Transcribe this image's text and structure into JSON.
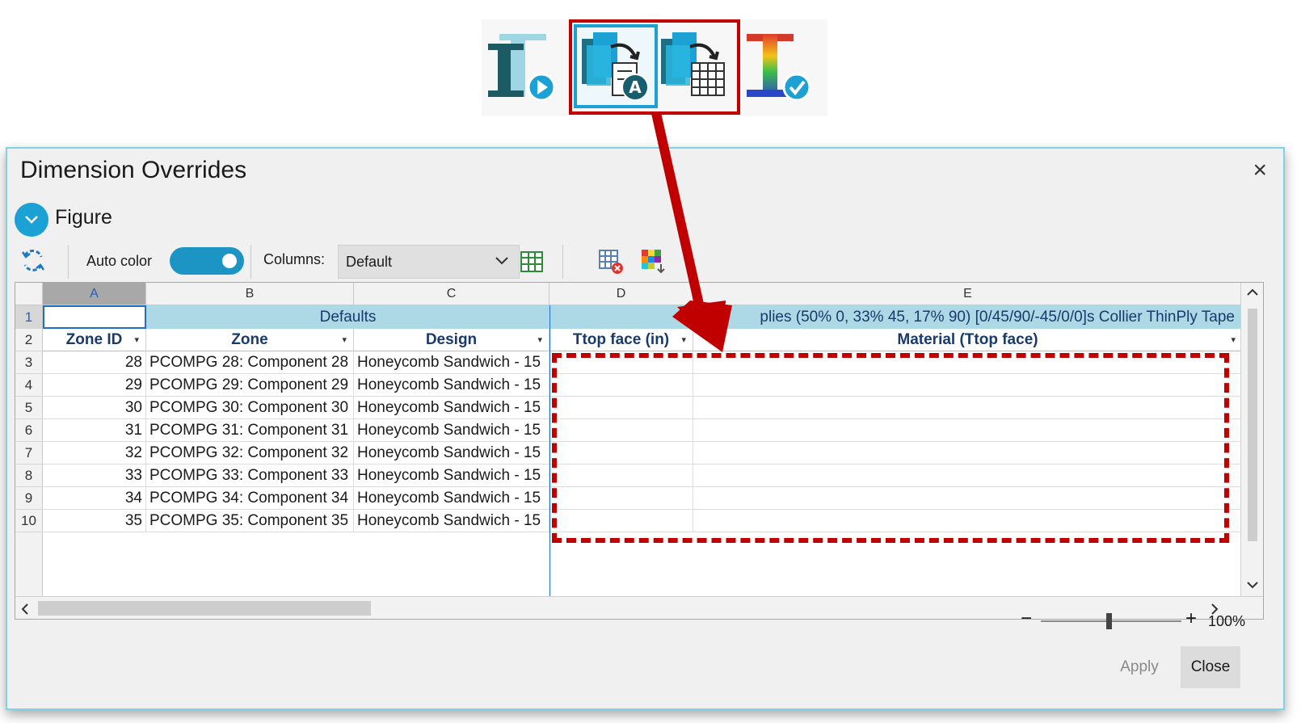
{
  "dialog": {
    "title": "Dimension Overrides",
    "close_glyph": "×",
    "section_label": "Figure"
  },
  "toolbar": {
    "auto_color_label": "Auto color",
    "auto_color_on": true,
    "columns_label": "Columns:",
    "columns_value": "Default"
  },
  "grid": {
    "col_letters": [
      "A",
      "B",
      "C",
      "D",
      "E"
    ],
    "row1_defaults": "Defaults",
    "row1_material": "plies (50% 0, 33% 45, 17% 90) [0/45/90/-45/0/0]s Collier ThinPly Tape",
    "headers": [
      "Zone ID",
      "Zone",
      "Design",
      "Ttop face (in)",
      "Material (Ttop face)"
    ],
    "row_numbers": [
      "1",
      "2",
      "3",
      "4",
      "5",
      "6",
      "7",
      "8",
      "9",
      "10"
    ],
    "rows": [
      {
        "id": "28",
        "zone": "PCOMPG 28: Component 28",
        "design": "Honeycomb Sandwich - 15"
      },
      {
        "id": "29",
        "zone": "PCOMPG 29: Component 29",
        "design": "Honeycomb Sandwich - 15"
      },
      {
        "id": "30",
        "zone": "PCOMPG 30: Component 30",
        "design": "Honeycomb Sandwich - 15"
      },
      {
        "id": "31",
        "zone": "PCOMPG 31: Component 31",
        "design": "Honeycomb Sandwich - 15"
      },
      {
        "id": "32",
        "zone": "PCOMPG 32: Component 32",
        "design": "Honeycomb Sandwich - 15"
      },
      {
        "id": "33",
        "zone": "PCOMPG 33: Component 33",
        "design": "Honeycomb Sandwich - 15"
      },
      {
        "id": "34",
        "zone": "PCOMPG 34: Component 34",
        "design": "Honeycomb Sandwich - 15"
      },
      {
        "id": "35",
        "zone": "PCOMPG 35: Component 35",
        "design": "Honeycomb Sandwich - 15"
      }
    ]
  },
  "footer": {
    "zoom_minus": "−",
    "zoom_plus": "+",
    "zoom_value": "100%",
    "apply_label": "Apply",
    "close_label": "Close"
  },
  "colors": {
    "accent": "#1ba1d4",
    "highlight_red": "#c00000",
    "row1_bg": "#add8e6"
  },
  "icons": [
    "refresh-icon",
    "columns-grid-icon",
    "clear-table-icon",
    "color-export-icon",
    "run-analysis-icon",
    "auto-table-icon",
    "table-import-icon",
    "check-icon"
  ]
}
